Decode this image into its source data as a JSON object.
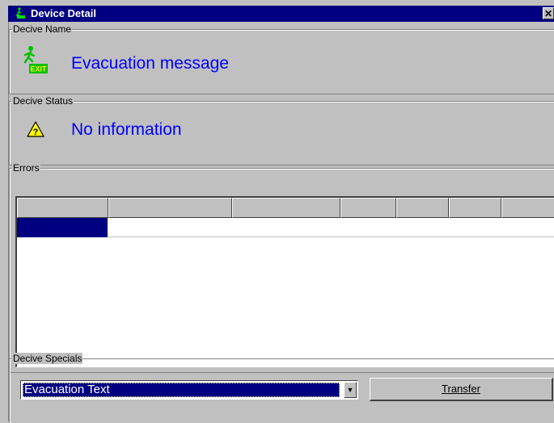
{
  "window": {
    "title": "Device Detail",
    "close_glyph": "✕",
    "title_icon": "exit-sign-icon"
  },
  "device_name": {
    "legend": "Decive Name",
    "value": "Evacuation message",
    "icon": "exit-sign-icon",
    "icon_text": "EXIT"
  },
  "device_status": {
    "legend": "Decive Status",
    "value": "No information",
    "icon": "warning-icon"
  },
  "errors": {
    "legend": "Errors",
    "columns": [
      "",
      "",
      "",
      "",
      "",
      "",
      ""
    ],
    "rows": [
      [
        "",
        "",
        "",
        "",
        "",
        "",
        ""
      ]
    ]
  },
  "device_specials": {
    "legend": "Decive Specials",
    "select_value": "Evacuation Text",
    "transfer_label": "Transfer"
  },
  "colors": {
    "title_bar": "#000080",
    "text_accent": "#0000ff",
    "face": "#c0c0c0",
    "exit_green": "#00c000"
  }
}
